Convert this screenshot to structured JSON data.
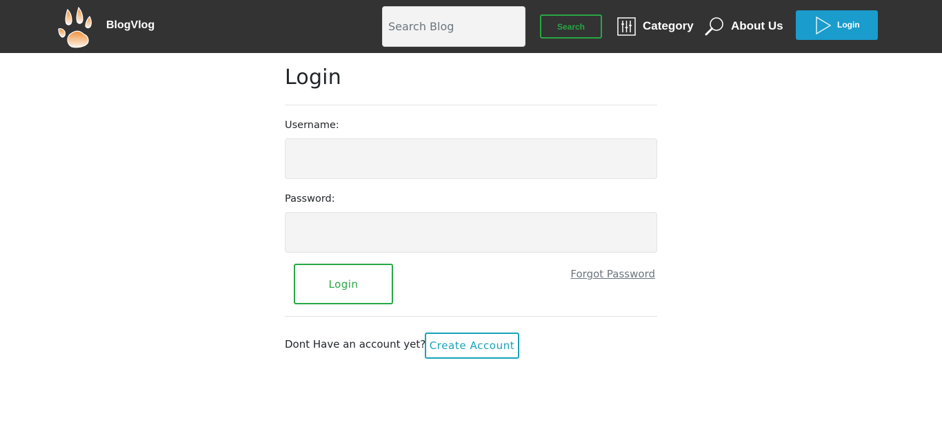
{
  "navbar": {
    "brand_name": "BlogVlog",
    "brand_icon": "paw-icon",
    "search": {
      "placeholder": "Search Blog",
      "value": "",
      "button_label": "Search"
    },
    "links": [
      {
        "label": "Category",
        "icon": "sliders-icon"
      },
      {
        "label": "About Us",
        "icon": "magnifier-icon"
      }
    ],
    "login_button": {
      "label": "Login",
      "icon": "play-triangle-icon"
    }
  },
  "login_form": {
    "title": "Login",
    "username_label": "Username:",
    "username_value": "",
    "password_label": "Password:",
    "password_value": "",
    "submit_label": "Login",
    "forgot_password_label": "Forgot Password",
    "no_account_text": "Dont Have an account yet?",
    "create_account_label": "Create Account"
  },
  "colors": {
    "navbar_bg": "#333333",
    "success_green": "#28a745",
    "info_teal": "#17a2b8",
    "login_blue": "#1a9ccc",
    "input_bg": "#f4f4f4"
  }
}
